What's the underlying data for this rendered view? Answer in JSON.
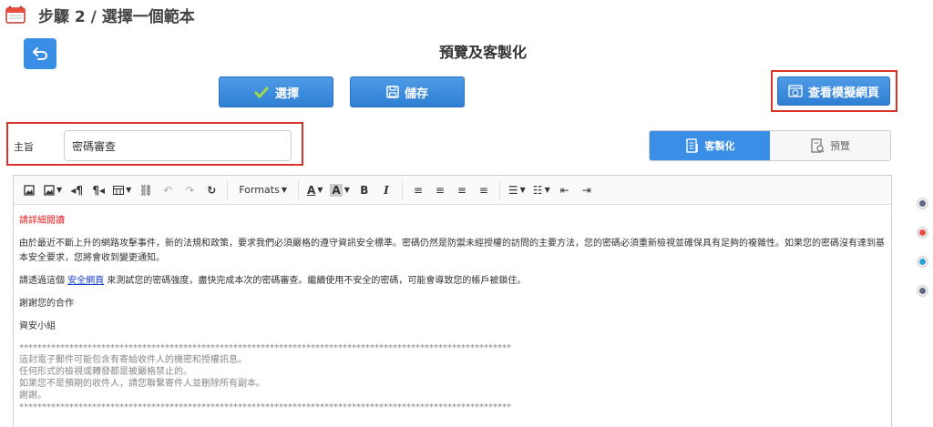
{
  "header": {
    "title": "步驟 2 / 選擇一個範本"
  },
  "main": {
    "title": "預覽及客製化"
  },
  "buttons": {
    "select": "選擇",
    "save": "儲存",
    "view_landing": "查看模擬網頁"
  },
  "subject": {
    "label": "主旨",
    "value": "密碼審查"
  },
  "mode_toggle": {
    "customize": "客製化",
    "preview": "預覽"
  },
  "toolbar": {
    "formats": "Formats"
  },
  "email": {
    "heading": "請詳細閱讀",
    "para1": "由於最近不斷上升的網路攻擊事件，新的法規和政策，要求我們必須嚴格的遵守資訊安全標準。密碼仍然是防禦未經授權的訪問的主要方法，您的密碼必須重新檢視並確保具有足夠的複雜性。如果您的密碼沒有達到基本安全要求，您將會收到變更通知。",
    "para2_before": "請透過這個 ",
    "para2_link": "安全網頁",
    "para2_after": " 來測試您的密碼強度，盡快完成本次的密碼審查。繼續使用不安全的密碼，可能會導致您的帳戶被鎖住。",
    "thanks": "謝謝您的合作",
    "sign": "資安小組",
    "separator": "************************************************************************************************************",
    "footer1": "這封電子郵件可能包含有寄給收件人的機密和授權訊息。",
    "footer2": "任何形式的檢視或轉發都是被嚴格禁止的。",
    "footer3": "如果您不是預期的收件人，請您聯繫寄件人並刪除所有副本。",
    "footer4": "謝謝。",
    "separator2": "************************************************************************************************************"
  },
  "colors": {
    "accent": "#3a8ee6",
    "highlight": "#d9342b",
    "dots": [
      "#5a6a85",
      "#e84c4c",
      "#2a9fd6",
      "#5a6a85"
    ]
  }
}
